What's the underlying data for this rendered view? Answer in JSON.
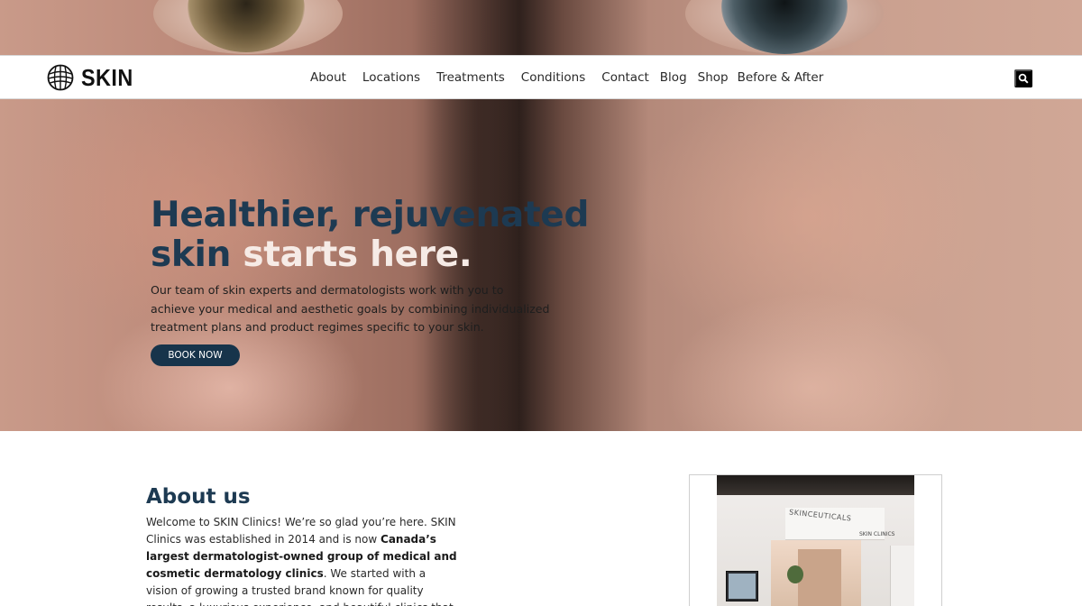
{
  "header": {
    "brand": "SKIN",
    "nav": [
      "About",
      "Locations",
      "Treatments",
      "Conditions",
      "Contact",
      "Blog",
      "Shop",
      "Before & After"
    ],
    "search_icon": "search-icon"
  },
  "hero": {
    "title_line1": "Healthier, rejuvenated",
    "title_line2_dark": "skin",
    "title_line2_light": "starts here.",
    "body_line1": "Our team of skin experts and dermatologists work with you to",
    "body_line2": "achieve your medical and aesthetic goals by combining individualized",
    "body_line3": "treatment plans and product regimes specific to your skin.",
    "cta_label": "BOOK NOW"
  },
  "about": {
    "title": "About us",
    "p1": "Welcome to SKIN Clinics! We’re so glad you’re here. SKIN Clinics was established in 2014 and is now ",
    "p1_bold": "Canada’s largest dermatologist-owned group of medical and cosmetic dermatology clinics",
    "p1_end": ". We started with a vision of growing a trusted brand known for quality results, a luxurious experience, and beautiful clinics that make you"
  },
  "colors": {
    "brand_navy": "#1d3a52",
    "button_navy": "#17344b",
    "accent_light": "#f6ebe6"
  }
}
